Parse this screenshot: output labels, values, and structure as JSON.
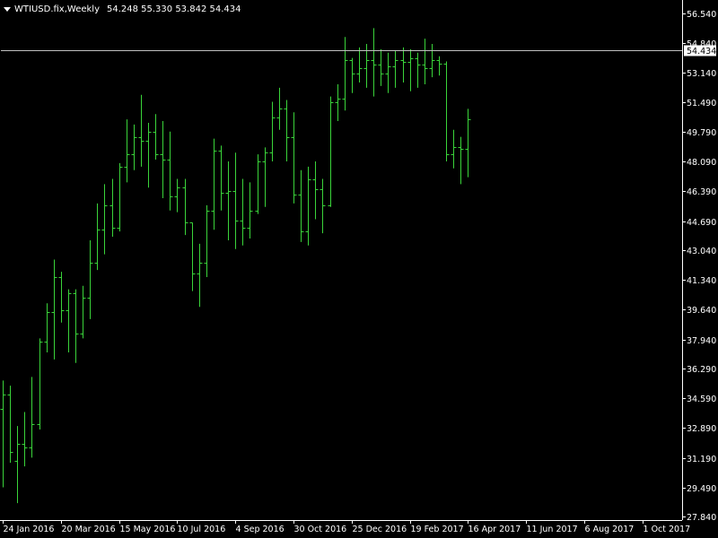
{
  "header": {
    "symbol": "WTIUSD.fix,Weekly",
    "ohlc": "54.248 55.330 53.842 54.434"
  },
  "colors": {
    "background": "#000000",
    "bars": "#3ad43a",
    "frame": "#ffffff",
    "price_line": "#c0c0c0",
    "label_bg": "#ffffff",
    "label_text": "#000000",
    "text": "#ffffff"
  },
  "chart_data": {
    "type": "ohlc",
    "title": "WTIUSD.fix,Weekly",
    "ylim": [
      27.84,
      57.4
    ],
    "y_ticks": [
      "56.540",
      "54.840",
      "53.140",
      "51.490",
      "49.790",
      "48.090",
      "46.390",
      "44.690",
      "43.040",
      "41.340",
      "39.640",
      "37.940",
      "36.290",
      "34.590",
      "32.890",
      "31.190",
      "29.490",
      "27.840"
    ],
    "x_ticks": [
      {
        "label": "24 Jan 2016",
        "bar": 0
      },
      {
        "label": "20 Mar 2016",
        "bar": 8
      },
      {
        "label": "15 May 2016",
        "bar": 16
      },
      {
        "label": "10 Jul 2016",
        "bar": 24
      },
      {
        "label": "4 Sep 2016",
        "bar": 32
      },
      {
        "label": "30 Oct 2016",
        "bar": 40
      },
      {
        "label": "25 Dec 2016",
        "bar": 48
      },
      {
        "label": "19 Feb 2017",
        "bar": 56
      },
      {
        "label": "16 Apr 2017",
        "bar": 64
      },
      {
        "label": "11 Jun 2017",
        "bar": 72
      },
      {
        "label": "6 Aug 2017",
        "bar": 80
      },
      {
        "label": "1 Oct 2017",
        "bar": 88
      }
    ],
    "current_price": "54.434",
    "bars": [
      {
        "o": 34.0,
        "h": 35.6,
        "l": 29.5,
        "c": 34.8
      },
      {
        "o": 34.8,
        "h": 35.3,
        "l": 30.9,
        "c": 31.5
      },
      {
        "o": 31.0,
        "h": 33.0,
        "l": 28.6,
        "c": 32.0
      },
      {
        "o": 32.0,
        "h": 33.8,
        "l": 30.7,
        "c": 31.8
      },
      {
        "o": 31.8,
        "h": 35.8,
        "l": 31.2,
        "c": 33.1
      },
      {
        "o": 33.1,
        "h": 38.0,
        "l": 32.8,
        "c": 37.8
      },
      {
        "o": 37.8,
        "h": 40.0,
        "l": 37.2,
        "c": 39.5
      },
      {
        "o": 39.5,
        "h": 42.5,
        "l": 36.8,
        "c": 41.5
      },
      {
        "o": 41.5,
        "h": 41.8,
        "l": 38.9,
        "c": 39.6
      },
      {
        "o": 39.6,
        "h": 40.8,
        "l": 37.2,
        "c": 40.6
      },
      {
        "o": 40.6,
        "h": 40.8,
        "l": 36.6,
        "c": 38.3
      },
      {
        "o": 38.3,
        "h": 41.0,
        "l": 38.0,
        "c": 40.3
      },
      {
        "o": 40.3,
        "h": 43.6,
        "l": 39.1,
        "c": 42.3
      },
      {
        "o": 42.3,
        "h": 45.7,
        "l": 41.9,
        "c": 44.2
      },
      {
        "o": 44.2,
        "h": 46.8,
        "l": 42.8,
        "c": 45.6
      },
      {
        "o": 45.6,
        "h": 47.1,
        "l": 43.8,
        "c": 44.3
      },
      {
        "o": 44.3,
        "h": 48.0,
        "l": 44.1,
        "c": 47.8
      },
      {
        "o": 47.8,
        "h": 50.5,
        "l": 46.9,
        "c": 48.5
      },
      {
        "o": 48.5,
        "h": 50.2,
        "l": 47.6,
        "c": 49.5
      },
      {
        "o": 49.5,
        "h": 51.9,
        "l": 47.8,
        "c": 49.3
      },
      {
        "o": 49.3,
        "h": 50.3,
        "l": 46.6,
        "c": 49.8
      },
      {
        "o": 49.8,
        "h": 50.8,
        "l": 48.2,
        "c": 48.5
      },
      {
        "o": 48.5,
        "h": 50.4,
        "l": 46.0,
        "c": 48.2
      },
      {
        "o": 48.2,
        "h": 49.8,
        "l": 45.3,
        "c": 46.1
      },
      {
        "o": 46.1,
        "h": 47.1,
        "l": 45.2,
        "c": 46.6
      },
      {
        "o": 46.6,
        "h": 47.1,
        "l": 43.9,
        "c": 44.6
      },
      {
        "o": 44.6,
        "h": 44.6,
        "l": 40.7,
        "c": 41.7
      },
      {
        "o": 41.7,
        "h": 43.4,
        "l": 39.8,
        "c": 42.3
      },
      {
        "o": 42.3,
        "h": 45.6,
        "l": 41.5,
        "c": 45.3
      },
      {
        "o": 45.3,
        "h": 49.4,
        "l": 44.2,
        "c": 48.7
      },
      {
        "o": 48.7,
        "h": 49.0,
        "l": 45.3,
        "c": 46.3
      },
      {
        "o": 46.3,
        "h": 48.1,
        "l": 43.6,
        "c": 46.4
      },
      {
        "o": 46.4,
        "h": 48.6,
        "l": 43.1,
        "c": 44.7
      },
      {
        "o": 44.7,
        "h": 47.1,
        "l": 43.3,
        "c": 44.3
      },
      {
        "o": 44.3,
        "h": 46.9,
        "l": 43.7,
        "c": 45.3
      },
      {
        "o": 45.3,
        "h": 48.5,
        "l": 45.1,
        "c": 48.1
      },
      {
        "o": 48.1,
        "h": 48.9,
        "l": 45.5,
        "c": 48.6
      },
      {
        "o": 48.6,
        "h": 51.5,
        "l": 48.1,
        "c": 50.6
      },
      {
        "o": 50.6,
        "h": 52.3,
        "l": 49.9,
        "c": 51.1
      },
      {
        "o": 51.1,
        "h": 51.6,
        "l": 48.1,
        "c": 49.5
      },
      {
        "o": 49.5,
        "h": 50.9,
        "l": 45.7,
        "c": 46.2
      },
      {
        "o": 46.2,
        "h": 47.6,
        "l": 43.5,
        "c": 44.1
      },
      {
        "o": 44.1,
        "h": 47.8,
        "l": 43.3,
        "c": 47.1
      },
      {
        "o": 47.1,
        "h": 48.1,
        "l": 44.8,
        "c": 46.5
      },
      {
        "o": 46.5,
        "h": 47.1,
        "l": 44.0,
        "c": 45.6
      },
      {
        "o": 45.6,
        "h": 51.8,
        "l": 45.5,
        "c": 51.5
      },
      {
        "o": 51.5,
        "h": 52.5,
        "l": 50.4,
        "c": 51.7
      },
      {
        "o": 51.7,
        "h": 55.2,
        "l": 51.0,
        "c": 53.9
      },
      {
        "o": 53.9,
        "h": 54.0,
        "l": 52.0,
        "c": 53.1
      },
      {
        "o": 53.1,
        "h": 54.6,
        "l": 52.6,
        "c": 53.4
      },
      {
        "o": 53.4,
        "h": 54.8,
        "l": 52.3,
        "c": 53.9
      },
      {
        "o": 53.9,
        "h": 55.7,
        "l": 51.8,
        "c": 53.6
      },
      {
        "o": 53.6,
        "h": 54.5,
        "l": 52.4,
        "c": 53.1
      },
      {
        "o": 53.1,
        "h": 54.3,
        "l": 52.0,
        "c": 53.5
      },
      {
        "o": 53.5,
        "h": 54.4,
        "l": 52.3,
        "c": 53.9
      },
      {
        "o": 53.9,
        "h": 54.6,
        "l": 52.6,
        "c": 53.8
      },
      {
        "o": 53.8,
        "h": 54.5,
        "l": 52.1,
        "c": 54.0
      },
      {
        "o": 54.0,
        "h": 54.3,
        "l": 52.3,
        "c": 53.6
      },
      {
        "o": 53.6,
        "h": 55.1,
        "l": 52.5,
        "c": 53.4
      },
      {
        "o": 53.4,
        "h": 54.8,
        "l": 52.9,
        "c": 53.9
      },
      {
        "o": 53.9,
        "h": 54.1,
        "l": 53.0,
        "c": 53.7
      },
      {
        "o": 53.7,
        "h": 53.8,
        "l": 48.1,
        "c": 48.5
      },
      {
        "o": 48.5,
        "h": 49.9,
        "l": 47.7,
        "c": 48.9
      },
      {
        "o": 48.9,
        "h": 49.5,
        "l": 46.8,
        "c": 48.8
      },
      {
        "o": 48.8,
        "h": 51.1,
        "l": 47.2,
        "c": 50.5
      }
    ]
  }
}
